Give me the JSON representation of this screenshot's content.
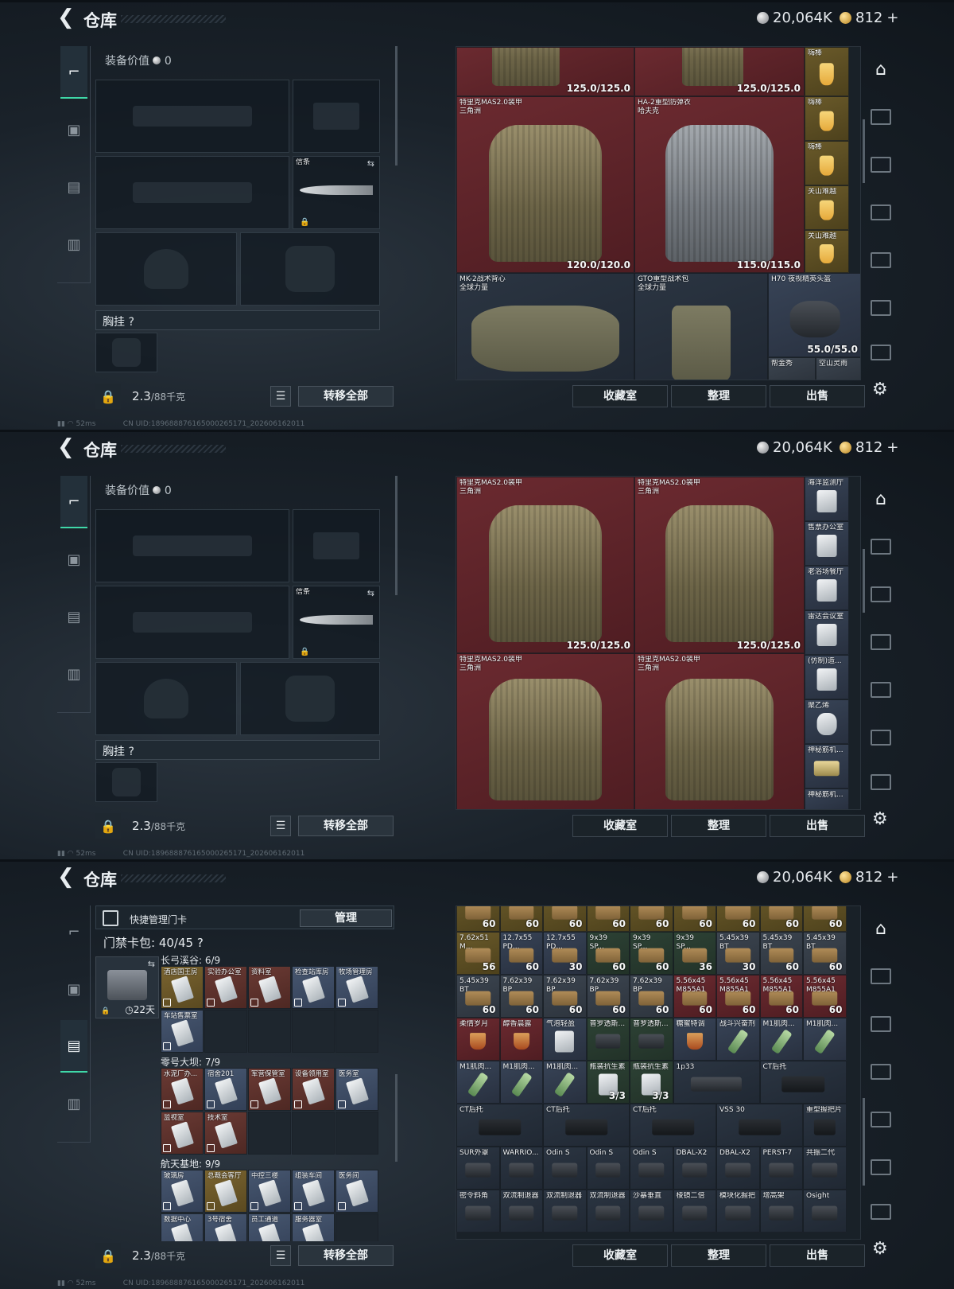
{
  "common": {
    "title": "仓库",
    "currency_silver": "20,064K",
    "currency_gold": "812",
    "gold_plus": "+",
    "equip_value_label": "装备价值",
    "equip_value": "0",
    "knife_label": "信条",
    "chest_label": "胸挂",
    "chest_help": "?",
    "weight_value": "2.3",
    "weight_unit": "/88千克",
    "transfer_all": "转移全部",
    "btn_collection": "收藏室",
    "btn_sort": "整理",
    "btn_sell": "出售",
    "latency": "52ms",
    "uid": "CN UID:1896888761650002651​71_202606162011"
  },
  "colors": {
    "accent": "#3fd8a8",
    "red_cell": "#5e2428",
    "blue_cell": "#384457"
  },
  "panel1": {
    "items": [
      {
        "name": "",
        "value": "125.0/125.0"
      },
      {
        "name": "",
        "value": "125.0/125.0"
      },
      {
        "name": "嗨棒",
        "value": ""
      },
      {
        "name": "特里克MAS2.0装甲\n三角洲",
        "value": "120.0/120.0"
      },
      {
        "name": "HA-2重型防弹衣\n哈夫克",
        "value": "115.0/115.0"
      },
      {
        "name": "嗨棒",
        "value": ""
      },
      {
        "name": "嗨棒",
        "value": ""
      },
      {
        "name": "关山难越",
        "value": ""
      },
      {
        "name": "关山难越",
        "value": ""
      },
      {
        "name": "MK-2战术背心\n全球力量",
        "value": ""
      },
      {
        "name": "GTO重型战术包\n全球力量",
        "value": ""
      },
      {
        "name": "H70 夜视精英头盔",
        "value": "55.0/55.0"
      },
      {
        "name": "帮金秀",
        "value": ""
      },
      {
        "name": "空山灵雨",
        "value": ""
      }
    ]
  },
  "panel2": {
    "items": [
      {
        "name": "特里克MAS2.0装甲\n三角洲",
        "value": "125.0/125.0"
      },
      {
        "name": "特里克MAS2.0装甲\n三角洲",
        "value": "125.0/125.0"
      },
      {
        "name": "特里克MAS2.0装甲\n三角洲",
        "value": ""
      },
      {
        "name": "特里克MAS2.0装甲\n三角洲",
        "value": ""
      },
      {
        "name": "海洋监测厅",
        "value": ""
      },
      {
        "name": "售票办公室",
        "value": ""
      },
      {
        "name": "老浴场餐厅",
        "value": ""
      },
      {
        "name": "雷达会议室",
        "value": ""
      },
      {
        "name": "(仿制)造...",
        "value": ""
      },
      {
        "name": "聚乙烯",
        "value": ""
      },
      {
        "name": "神秘筋机...",
        "value": ""
      },
      {
        "name": "神秘筋机...",
        "value": ""
      }
    ]
  },
  "panel3": {
    "keycard_title": "快捷管理门卡",
    "manage": "管理",
    "keycard_bag": "门禁卡包: 40/45",
    "bag_days": "22天",
    "groups": [
      {
        "title": "长弓溪谷: 6/9",
        "cards": [
          "酒店国王房",
          "实验办公室",
          "资料室",
          "检查站库房",
          "牧场管理房",
          "车站售票室"
        ]
      },
      {
        "title": "零号大坝: 7/9",
        "cards": [
          "水泥厂办...",
          "宿舍201",
          "军营保管室",
          "设备领用室",
          "医务室",
          "监视室",
          "技术室"
        ]
      },
      {
        "title": "航天基地: 9/9",
        "cards": [
          "玻璃房",
          "总裁会客厅",
          "中控三楼",
          "组装车间",
          "医务间",
          "数据中心",
          "3号宿舍",
          "员工通道",
          "服务器室"
        ]
      }
    ],
    "ammo_row0": [
      "60",
      "60",
      "60",
      "60",
      "60",
      "60",
      "60",
      "60",
      "60"
    ],
    "ammo_row1": [
      {
        "name": "7.62x51\nM...",
        "value": "56"
      },
      {
        "name": "12.7x55\nPD...",
        "value": "60"
      },
      {
        "name": "12.7x55\nPD...",
        "value": "30"
      },
      {
        "name": "9x39\nSP...",
        "value": "60"
      },
      {
        "name": "9x39\nSP...",
        "value": "60"
      },
      {
        "name": "9x39\nSP...",
        "value": "36"
      },
      {
        "name": "5.45x39\nBT",
        "value": "30"
      },
      {
        "name": "5.45x39\nBT",
        "value": "60"
      },
      {
        "name": "5.45x39\nBT",
        "value": "60"
      }
    ],
    "ammo_row2": [
      {
        "name": "5.45x39\nBT",
        "value": "60"
      },
      {
        "name": "7.62x39\nBP",
        "value": "60"
      },
      {
        "name": "7.62x39\nBP",
        "value": "60"
      },
      {
        "name": "7.62x39\nBP",
        "value": "60"
      },
      {
        "name": "7.62x39\nBP",
        "value": "60"
      },
      {
        "name": "5.56x45\nM855A1",
        "value": "60"
      },
      {
        "name": "5.56x45\nM855A1",
        "value": "60"
      },
      {
        "name": "5.56x45\nM855A1",
        "value": "60"
      },
      {
        "name": "5.56x45\nM855A1",
        "value": "60"
      }
    ],
    "row3": [
      "柔情岁月",
      "醇香晨露",
      "气泡轻盈",
      "普罗透斯...",
      "普罗透斯...",
      "糖蜜特调",
      "战斗兴奋剂",
      "M1肌肉...",
      "M1肌肉..."
    ],
    "row4": [
      {
        "name": "M1肌肉...",
        "value": ""
      },
      {
        "name": "M1肌肉...",
        "value": ""
      },
      {
        "name": "M1肌肉...",
        "value": ""
      },
      {
        "name": "瓶装抗生素",
        "value": "3/3"
      },
      {
        "name": "瓶装抗生素",
        "value": "3/3"
      },
      {
        "name": "1p33",
        "value": ""
      },
      {
        "name": "CT后托",
        "value": ""
      }
    ],
    "row5": [
      "CT后托",
      "CT后托",
      "CT后托",
      "VSS 30",
      "重型握把片"
    ],
    "row6": [
      "SUR外罩",
      "WARRIO...",
      "Odin S",
      "Odin S",
      "Odin S",
      "DBAL-X2",
      "DBAL-X2",
      "PERST-7",
      "共振二代"
    ],
    "row7": [
      "密令斜角",
      "双流制退器",
      "双流制退器",
      "双流制退器",
      "沙暴垂直",
      "棱镜二倍",
      "模块化握把",
      "增高架",
      "Osight"
    ]
  }
}
